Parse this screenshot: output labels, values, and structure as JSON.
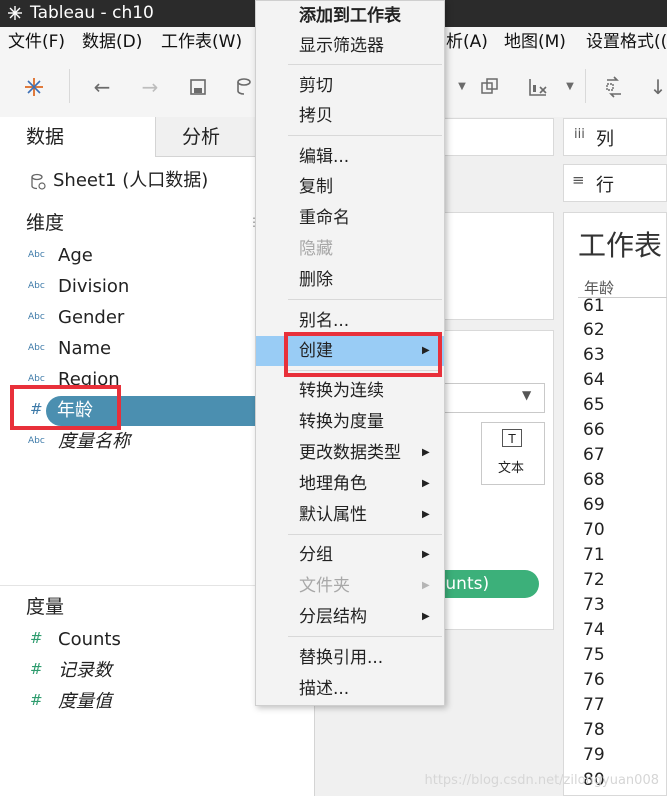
{
  "window": {
    "title": "Tableau - ch10"
  },
  "menubar": {
    "items": [
      "文件(F)",
      "数据(D)",
      "工作表(W)",
      "析(A)",
      "地图(M)",
      "设置格式(("
    ]
  },
  "data_pane": {
    "tab_data": "数据",
    "tab_analysis": "分析",
    "datasource": "Sheet1 (人口数据)",
    "dimensions_header": "维度",
    "dimensions": [
      {
        "icon": "Abc",
        "label": "Age"
      },
      {
        "icon": "Abc",
        "label": "Division"
      },
      {
        "icon": "Abc",
        "label": "Gender"
      },
      {
        "icon": "Abc",
        "label": "Name"
      },
      {
        "icon": "Abc",
        "label": "Region"
      },
      {
        "icon": "#",
        "label": "年龄"
      },
      {
        "icon": "Abc",
        "label": "度量名称"
      }
    ],
    "measures_header": "度量",
    "measures": [
      {
        "icon": "#",
        "label": "Counts"
      },
      {
        "icon": "#",
        "label": "记录数"
      },
      {
        "icon": "#",
        "label": "度量值"
      }
    ]
  },
  "shelves": {
    "columns_label": "列",
    "rows_label": "行"
  },
  "marks": {
    "text_label": "文本",
    "pill_label": "ounts)"
  },
  "worksheet": {
    "title": "工作表",
    "header": "年龄",
    "rows": [
      "61",
      "62",
      "63",
      "64",
      "65",
      "66",
      "67",
      "68",
      "69",
      "70",
      "71",
      "72",
      "73",
      "74",
      "75",
      "76",
      "77",
      "78",
      "79",
      "80"
    ]
  },
  "context_menu": {
    "items": [
      {
        "label": "添加到工作表",
        "bold": true
      },
      {
        "label": "显示筛选器"
      },
      {
        "sep": true
      },
      {
        "label": "剪切"
      },
      {
        "label": "拷贝"
      },
      {
        "sep": true
      },
      {
        "label": "编辑..."
      },
      {
        "label": "复制"
      },
      {
        "label": "重命名"
      },
      {
        "label": "隐藏",
        "disabled": true
      },
      {
        "label": "删除"
      },
      {
        "sep": true
      },
      {
        "label": "别名..."
      },
      {
        "label": "创建",
        "submenu": true,
        "highlighted": true
      },
      {
        "sep": true
      },
      {
        "label": "转换为连续"
      },
      {
        "label": "转换为度量"
      },
      {
        "label": "更改数据类型",
        "submenu": true
      },
      {
        "label": "地理角色",
        "submenu": true
      },
      {
        "label": "默认属性",
        "submenu": true
      },
      {
        "sep": true
      },
      {
        "label": "分组",
        "submenu": true
      },
      {
        "label": "文件夹",
        "submenu": true,
        "disabled": true
      },
      {
        "label": "分层结构",
        "submenu": true
      },
      {
        "sep": true
      },
      {
        "label": "替换引用..."
      },
      {
        "label": "描述..."
      }
    ]
  },
  "watermark": "https://blog.csdn.net/zilongyuan008",
  "colors": {
    "titlebar": "#2b2b2b",
    "selected_field": "#4b8fb0",
    "highlight_menu": "#99ccf5",
    "annotation_red": "#e8303a",
    "measure_green": "#2e9c6e"
  }
}
